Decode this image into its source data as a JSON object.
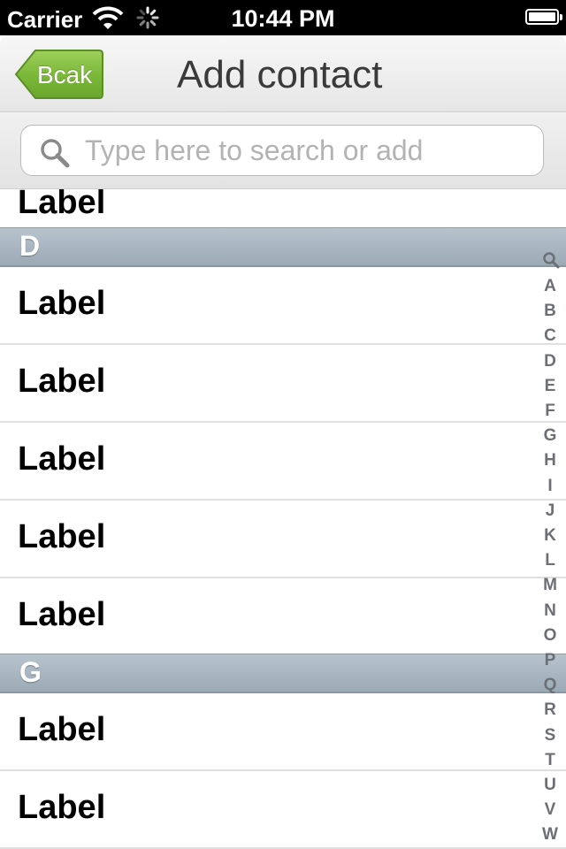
{
  "status_bar": {
    "carrier": "Carrier",
    "time": "10:44 PM"
  },
  "nav": {
    "back_label": "Bcak",
    "title": "Add contact"
  },
  "search": {
    "placeholder": "Type here to search or add"
  },
  "list": {
    "top_partial_label": "Label",
    "sections": [
      {
        "letter": "D",
        "rows": [
          "Label",
          "Label",
          "Label",
          "Label",
          "Label"
        ]
      },
      {
        "letter": "G",
        "rows": [
          "Label",
          "Label"
        ]
      }
    ]
  },
  "index": {
    "letters": [
      "A",
      "B",
      "C",
      "D",
      "E",
      "F",
      "G",
      "H",
      "I",
      "J",
      "K",
      "L",
      "M",
      "N",
      "O",
      "P",
      "Q",
      "R",
      "S",
      "T",
      "U",
      "V",
      "W"
    ]
  },
  "colors": {
    "back_button_green": "#7cb83a",
    "section_header": "#a9b6c1",
    "index_text": "#6c6f75"
  }
}
